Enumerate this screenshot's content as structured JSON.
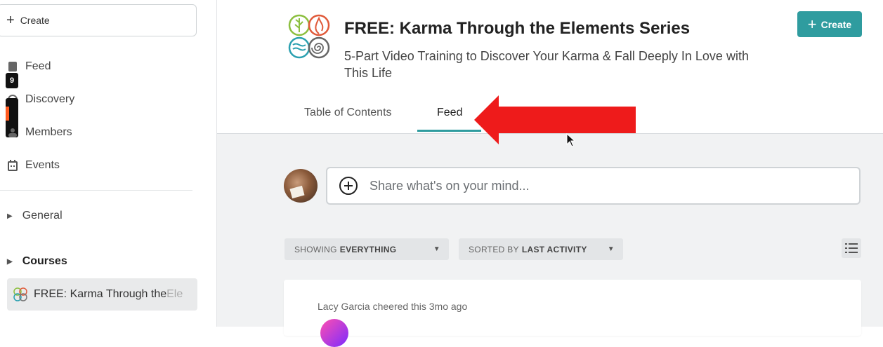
{
  "sidebar": {
    "create_label": "Create",
    "badges": [
      "9",
      ""
    ],
    "items": [
      {
        "label": "Feed",
        "icon": "feed-icon"
      },
      {
        "label": "Discovery",
        "icon": "discovery-icon"
      },
      {
        "label": "Members",
        "icon": "members-icon"
      },
      {
        "label": "Events",
        "icon": "calendar-icon"
      }
    ],
    "groups": [
      {
        "label": "General"
      },
      {
        "label": "Courses"
      }
    ],
    "active_course": {
      "label_visible": "FREE: Karma Through the ",
      "label_faded": "Ele"
    }
  },
  "header": {
    "title": "FREE: Karma Through the Elements Series",
    "subtitle": "5-Part Video Training to Discover Your Karma & Fall Deeply In Love with This Life",
    "create_button": "Create"
  },
  "tabs": [
    {
      "label": "Table of Contents",
      "active": false
    },
    {
      "label": "Feed",
      "active": true
    }
  ],
  "composer": {
    "placeholder": "Share what's on your mind..."
  },
  "filters": {
    "showing_prefix": "SHOWING",
    "showing_value": "EVERYTHING",
    "sorted_prefix": "SORTED BY",
    "sorted_value": "LAST ACTIVITY"
  },
  "feed": {
    "activity_text": "Lacy Garcia cheered this 3mo ago"
  },
  "colors": {
    "accent": "#2f9c9f",
    "arrow": "#ee1b1b",
    "sidebar_active_bg": "#e9eaeb",
    "feed_bg": "#f1f2f3"
  }
}
